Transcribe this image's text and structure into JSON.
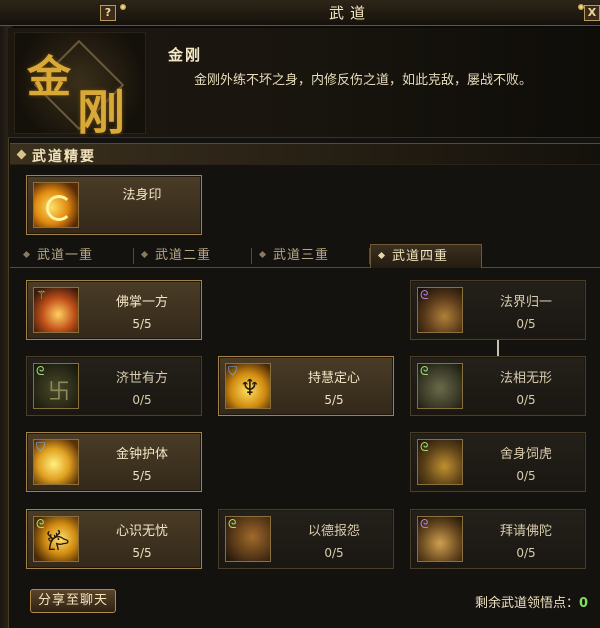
{
  "window": {
    "title": "武道",
    "help_label": "?",
    "close_label": "X"
  },
  "header": {
    "emblem_chars": [
      "金",
      "刚"
    ],
    "name": "金刚",
    "description": "金刚外练不坏之身，内修反伤之道，如此克敌，屡战不败。"
  },
  "essence": {
    "section_label": "武道精要",
    "skill": {
      "name": "法身印",
      "icon": "golden-seal-icon"
    }
  },
  "tabs": [
    {
      "label": "武道一重",
      "active": false
    },
    {
      "label": "武道二重",
      "active": false
    },
    {
      "label": "武道三重",
      "active": false
    },
    {
      "label": "武道四重",
      "active": true
    }
  ],
  "skills": [
    {
      "name": "佛掌一方",
      "level": "5/5",
      "icon": "buddha-palm-icon"
    },
    {
      "name": "法界归一",
      "level": "0/5",
      "icon": "dharma-realm-icon"
    },
    {
      "name": "济世有方",
      "level": "0/5",
      "icon": "swastika-icon"
    },
    {
      "name": "持慧定心",
      "level": "5/5",
      "icon": "meditation-icon"
    },
    {
      "name": "法相无形",
      "level": "0/5",
      "icon": "dharma-form-icon"
    },
    {
      "name": "金钟护体",
      "level": "5/5",
      "icon": "golden-bell-icon"
    },
    {
      "name": "舍身饲虎",
      "level": "0/5",
      "icon": "sacrifice-icon"
    },
    {
      "name": "心识无忧",
      "level": "5/5",
      "icon": "mind-calm-icon"
    },
    {
      "name": "以德报怨",
      "level": "0/5",
      "icon": "virtue-icon"
    },
    {
      "name": "拜请佛陀",
      "level": "0/5",
      "icon": "pray-buddha-icon"
    }
  ],
  "footer": {
    "share_label": "分享至聊天",
    "points_label": "剩余武道领悟点：",
    "points_value": "0"
  },
  "colors": {
    "accent_gold": "#d9a938",
    "points_green": "#7fe05a",
    "frame": "#6e5a36"
  }
}
